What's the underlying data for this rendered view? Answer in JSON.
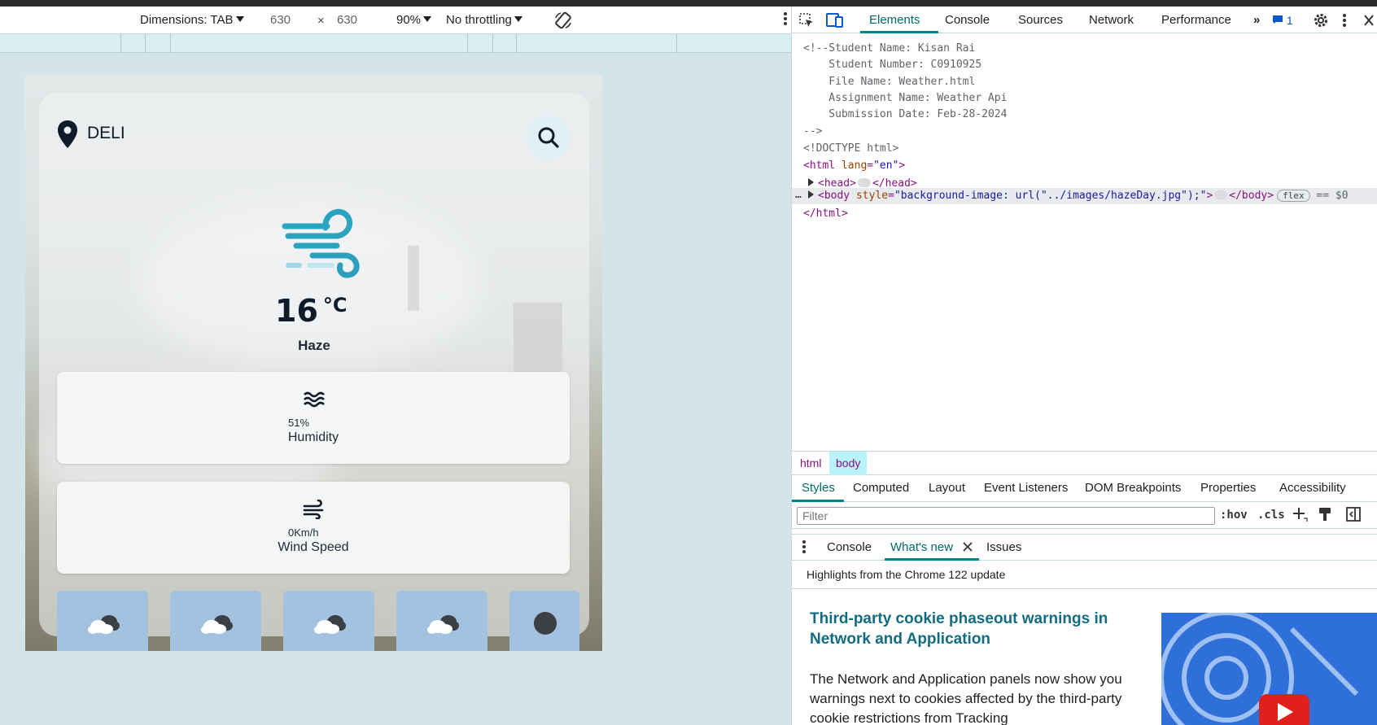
{
  "emulation_toolbar": {
    "dimensions_label": "Dimensions: TAB",
    "width_value": "630",
    "times_sign": "×",
    "height_value": "630",
    "zoom": "90%",
    "throttling": "No throttling"
  },
  "weather_app": {
    "location": "DELI",
    "temperature": "16",
    "temperature_unit": "°C",
    "condition": "Haze",
    "humidity": {
      "value": "51%",
      "label": "Humidity"
    },
    "wind_speed": {
      "value": "0Km/h",
      "label": "Wind Speed"
    },
    "forecast_icons": [
      "cloud-icon",
      "cloud-icon",
      "cloud-icon",
      "cloud-icon",
      "moon-icon"
    ]
  },
  "devtools": {
    "tabs": [
      "Elements",
      "Console",
      "Sources",
      "Network",
      "Performance"
    ],
    "active_tab": "Elements",
    "issues_count": "1",
    "dom": {
      "comment_lines": [
        "<!--Student Name: Kisan Rai",
        "    Student Number: C0910925",
        "    File Name: Weather.html",
        "    Assignment Name: Weather Api",
        "    Submission Date: Feb-28-2024",
        "-->"
      ],
      "doctype": "<!DOCTYPE html>",
      "html_open_tag": "<html",
      "html_lang_attr": "lang",
      "html_lang_val": "\"en\"",
      "html_close": ">",
      "head_open": "<head>",
      "head_close": "</head>",
      "body_open": "<body",
      "body_style_attr": "style",
      "body_style_val": "\"background-image: url(\"../images/hazeDay.jpg\");\"",
      "body_gt": ">",
      "body_close": "</body>",
      "body_badge": "flex",
      "body_eq": "== $0",
      "row_dots": "…",
      "html_end": "</html>"
    },
    "breadcrumbs": [
      "html",
      "body"
    ],
    "sub_tabs": [
      "Styles",
      "Computed",
      "Layout",
      "Event Listeners",
      "DOM Breakpoints",
      "Properties",
      "Accessibility"
    ],
    "active_sub_tab": "Styles",
    "filter_placeholder": "Filter",
    "hov": ":hov",
    "cls": ".cls",
    "drawer_tabs": [
      "Console",
      "What's new",
      "Issues"
    ],
    "active_drawer_tab": "What's new",
    "highlights": "Highlights from the Chrome 122 update",
    "article_title": "Third-party cookie phaseout warnings in Network and Application",
    "article_body": "The Network and Application panels now show you warnings next to cookies affected by the third-party cookie restrictions from Tracking"
  }
}
